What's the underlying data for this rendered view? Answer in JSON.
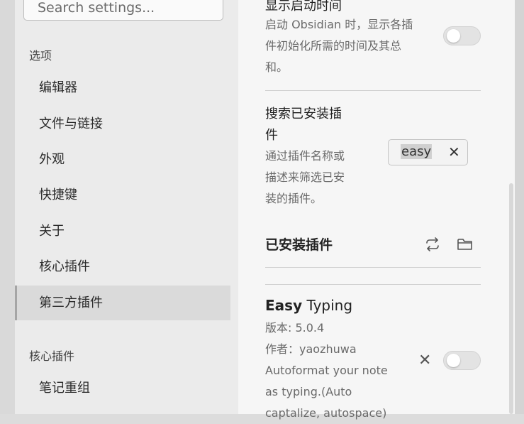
{
  "sidebar": {
    "search_placeholder": "Search settings...",
    "sections": [
      {
        "label": "选项",
        "items": [
          "编辑器",
          "文件与链接",
          "外观",
          "快捷键",
          "关于",
          "核心插件",
          "第三方插件"
        ]
      },
      {
        "label": "核心插件",
        "items": [
          "笔记重组"
        ]
      }
    ],
    "active_item": "第三方插件"
  },
  "settings": {
    "startup_time": {
      "title": "显示启动时间",
      "description": [
        "启动 Obsidian 时，显示各插",
        "件初始化所需的时间及其总",
        "和。"
      ],
      "enabled": false
    },
    "search_installed": {
      "title": [
        "搜索已安装插",
        "件"
      ],
      "description": [
        "通过插件名称或",
        "描述来筛选已安",
        "装的插件。"
      ],
      "filter_value": "easy",
      "clear_icon": "close-icon"
    },
    "installed_heading": "已安装插件",
    "heading_icons": [
      "reload-icon",
      "folder-icon"
    ]
  },
  "plugin": {
    "name_bold": "Easy",
    "name_rest": " Typing",
    "version": "版本: 5.0.4",
    "author": "作者：yaozhuwa",
    "description": [
      "Autoformat your note",
      "as typing.(Auto",
      "captalize, autospace)"
    ],
    "enabled": false
  },
  "colors": {
    "modal_background": "#f6f6f6",
    "sidebar_background": "#ebebeb",
    "active_item_background": "#dadada"
  }
}
